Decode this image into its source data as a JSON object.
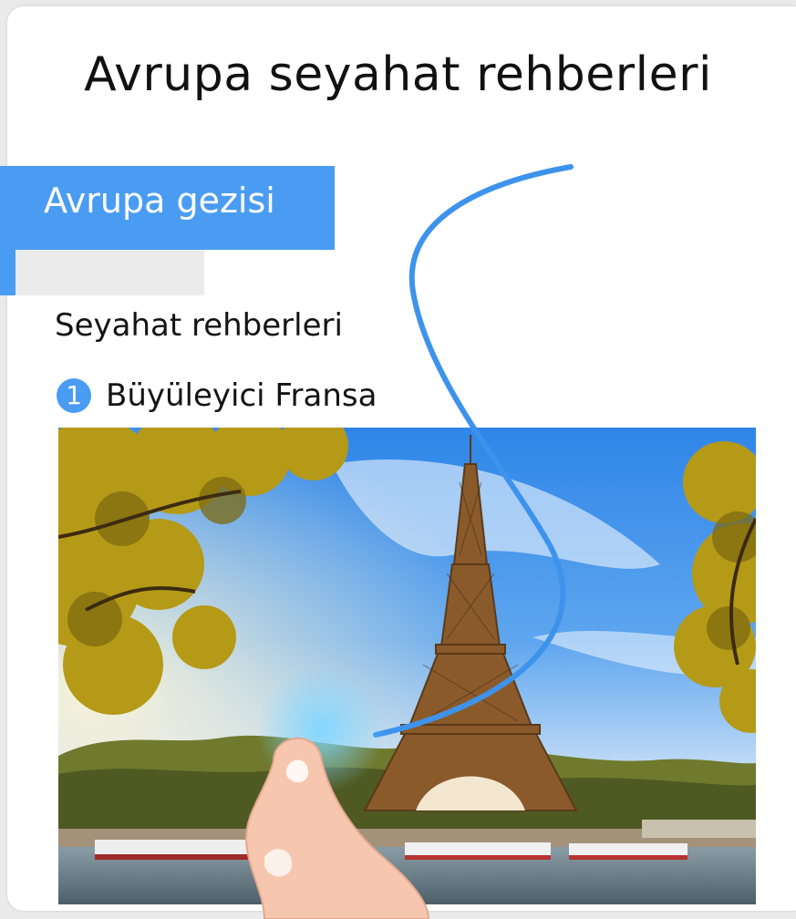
{
  "header": {
    "title": "Avrupa seyahat rehberleri"
  },
  "tab": {
    "label": "Avrupa gezisi"
  },
  "content": {
    "section_heading": "Seyahat rehberleri",
    "items": [
      {
        "number": "1",
        "label": "Büyüleyici Fransa"
      }
    ]
  },
  "photo": {
    "subject": "eiffel-tower-photo"
  },
  "gesture": {
    "icon": "finger-swipe-icon"
  },
  "colors": {
    "accent": "#4a9cf2",
    "gesture_stroke": "#3d93ec",
    "placeholder": "#ebebeb",
    "text": "#111111"
  }
}
